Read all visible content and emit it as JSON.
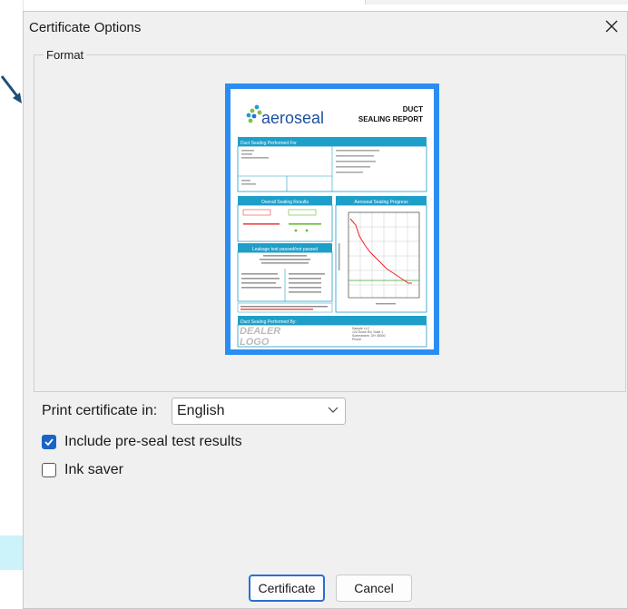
{
  "dialog": {
    "title": "Certificate Options",
    "format_label": "Format",
    "language_label": "Print certificate in:",
    "language_value": "English",
    "include_preseal_label": "Include pre-seal test results",
    "include_preseal_checked": true,
    "ink_saver_label": "Ink saver",
    "ink_saver_checked": false,
    "certificate_button": "Certificate",
    "cancel_button": "Cancel"
  },
  "preview": {
    "brand": "aeroseal",
    "report_title_1": "DUCT",
    "report_title_2": "SEALING REPORT",
    "section_performed_for": "Duct Sealing Performed For",
    "section_overall": "Overall Sealing Results",
    "section_progress": "Aeroseal Sealing Progress",
    "section_leakage": "Leakage test passed/not passed",
    "section_performed_by": "Duct Sealing Performed By:",
    "dealer_logo_1": "DEALER",
    "dealer_logo_2": "LOGO",
    "dealer_lines": [
      "Sample LLC",
      "123 Some Rd, Suite 1",
      "Somewhere, OH 45000",
      "Phone"
    ]
  },
  "colors": {
    "accent": "#1a63c6",
    "preview_frame": "#2b8df2",
    "report_header": "#1e9fc9"
  }
}
